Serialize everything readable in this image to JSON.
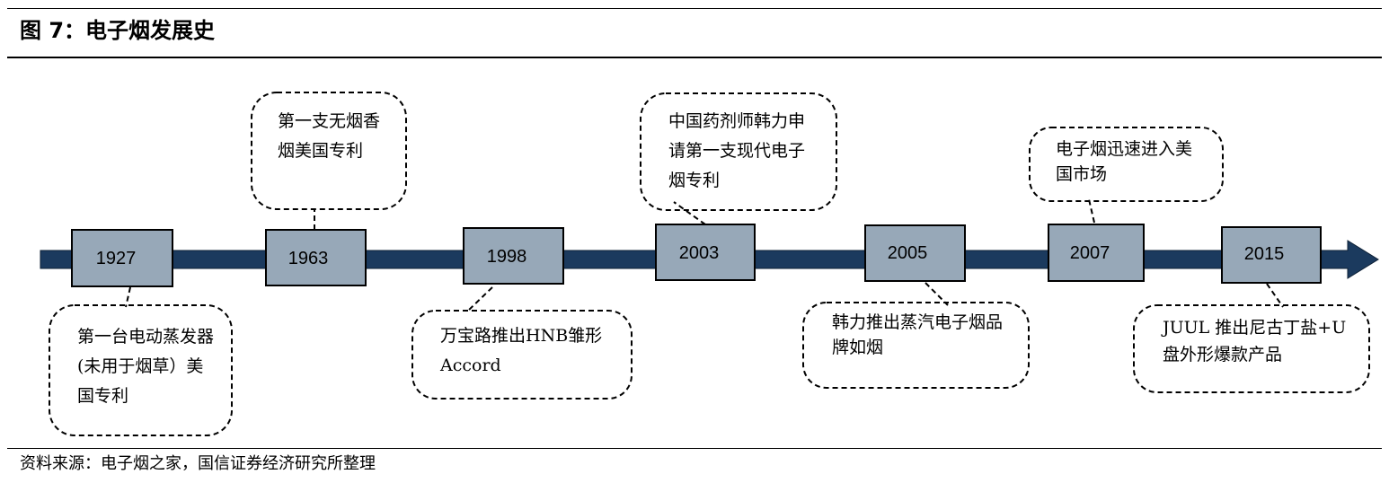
{
  "title": "图 7：电子烟发展史",
  "source": "资料来源：电子烟之家，国信证券经济研究所整理",
  "colors": {
    "arrow_fill": "#1b3a5e",
    "box_fill": "#97a8b8",
    "box_stroke": "#000000",
    "callout_stroke": "#000000"
  },
  "timeline": [
    {
      "year": "1927",
      "event": "第一台电动蒸发器(未用于烟草）美国专利",
      "position": "below"
    },
    {
      "year": "1963",
      "event": "第一支无烟香烟美国专利",
      "position": "above"
    },
    {
      "year": "1998",
      "event": "万宝路推出HNB雏形 Accord",
      "position": "below"
    },
    {
      "year": "2003",
      "event": "中国药剂师韩力申请第一支现代电子烟专利",
      "position": "above"
    },
    {
      "year": "2005",
      "event": "韩力推出蒸汽电子烟品牌如烟",
      "position": "below"
    },
    {
      "year": "2007",
      "event": "电子烟迅速进入美国市场",
      "position": "above"
    },
    {
      "year": "2015",
      "event": "JUUL 推出尼古丁盐+U 盘外形爆款产品",
      "position": "below"
    }
  ]
}
